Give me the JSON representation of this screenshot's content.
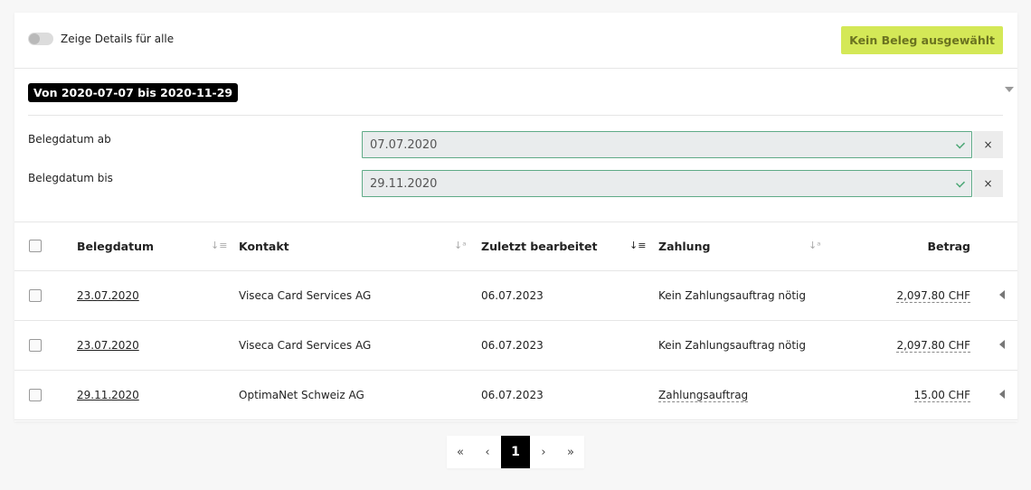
{
  "toolbar": {
    "toggle_label": "Zeige Details für alle",
    "toggle_on": false,
    "action_button": "Kein Beleg ausgewählt"
  },
  "filter": {
    "range_badge": "Von 2020-07-07 bis 2020-11-29",
    "fields": [
      {
        "label": "Belegdatum ab",
        "value": "07.07.2020",
        "clear": "×"
      },
      {
        "label": "Belegdatum bis",
        "value": "29.11.2020",
        "clear": "×"
      }
    ]
  },
  "table": {
    "columns": [
      {
        "label": "Belegdatum",
        "sort_icon": "sort-desc-icon"
      },
      {
        "label": "Kontakt",
        "sort_icon": "sort-alpha-icon"
      },
      {
        "label": "Zuletzt bearbeitet",
        "sort_icon": "sort-desc-active-icon"
      },
      {
        "label": "Zahlung",
        "sort_icon": "sort-alpha-icon"
      },
      {
        "label": "Betrag",
        "sort_icon": ""
      }
    ],
    "rows": [
      {
        "date": "23.07.2020",
        "contact": "Viseca Card Services AG",
        "edited": "06.07.2023",
        "payment": "Kein Zahlungsauftrag nötig",
        "payment_link": false,
        "amount": "2,097.80 CHF"
      },
      {
        "date": "23.07.2020",
        "contact": "Viseca Card Services AG",
        "edited": "06.07.2023",
        "payment": "Kein Zahlungsauftrag nötig",
        "payment_link": false,
        "amount": "2,097.80 CHF"
      },
      {
        "date": "29.11.2020",
        "contact": "OptimaNet Schweiz AG",
        "edited": "06.07.2023",
        "payment": "Zahlungsauftrag",
        "payment_link": true,
        "amount": "15.00 CHF"
      }
    ]
  },
  "pagination": {
    "first": "«",
    "prev": "‹",
    "current": "1",
    "next": "›",
    "last": "»"
  },
  "colors": {
    "accent": "#d4e857",
    "valid_border": "#5fab87",
    "badge_bg": "#000000"
  }
}
